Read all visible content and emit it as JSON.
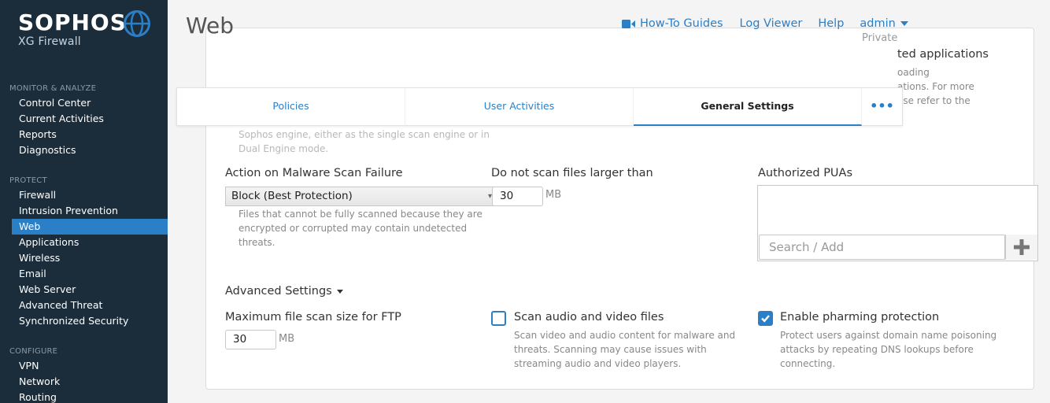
{
  "brand": {
    "name": "SOPHOS",
    "product": "XG Firewall"
  },
  "sidebar": {
    "sections": [
      {
        "header": "MONITOR & ANALYZE",
        "items": [
          "Control Center",
          "Current Activities",
          "Reports",
          "Diagnostics"
        ]
      },
      {
        "header": "PROTECT",
        "items": [
          "Firewall",
          "Intrusion Prevention",
          "Web",
          "Applications",
          "Wireless",
          "Email",
          "Web Server",
          "Advanced Threat",
          "Synchronized Security"
        ]
      },
      {
        "header": "CONFIGURE",
        "items": [
          "VPN",
          "Network",
          "Routing"
        ]
      }
    ],
    "active_item": "Web"
  },
  "header": {
    "title": "Web",
    "links": {
      "guides": "How-To Guides",
      "log_viewer": "Log Viewer",
      "help": "Help",
      "admin": "admin"
    },
    "private_label": "Private"
  },
  "tabs": [
    {
      "label": "Policies",
      "active": false
    },
    {
      "label": "User Activities",
      "active": false
    },
    {
      "label": "General Settings",
      "active": true
    }
  ],
  "tabs_more": "•••",
  "partial": {
    "title": "ted applications",
    "desc_lines": [
      "oading",
      "ations. For more",
      "ase refer to the"
    ]
  },
  "engine_help_lines": [
    "Sophos engine, either as the single scan engine or in",
    "Dual Engine mode."
  ],
  "malware_fail": {
    "label": "Action on Malware Scan Failure",
    "value": "Block (Best Protection)",
    "help_lines": [
      "Files that cannot be fully scanned because they are",
      "encrypted or corrupted may contain undetected",
      "threats."
    ]
  },
  "max_size": {
    "label": "Do not scan files larger than",
    "value": "30",
    "unit": "MB"
  },
  "pua": {
    "label": "Authorized PUAs",
    "placeholder": "Search / Add"
  },
  "advanced": {
    "label": "Advanced Settings"
  },
  "ftp": {
    "label": "Maximum file scan size for FTP",
    "value": "30",
    "unit": "MB"
  },
  "scan_av": {
    "label": "Scan audio and video files",
    "checked": false,
    "help_lines": [
      "Scan video and audio content for malware and",
      "threats. Scanning may cause issues with",
      "streaming audio and video players."
    ]
  },
  "pharming": {
    "label": "Enable pharming protection",
    "checked": true,
    "help_lines": [
      "Protect users against domain name poisoning",
      "attacks by repeating DNS lookups before",
      "connecting."
    ]
  },
  "colors": {
    "sidebar_bg": "#1b2d3b",
    "accent": "#2b7fc6",
    "active_nav": "#2b7fc6"
  }
}
